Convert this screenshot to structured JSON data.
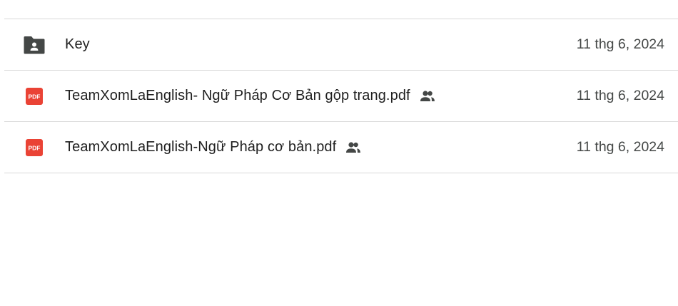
{
  "files": [
    {
      "type": "shared-folder",
      "icon": "shared-folder-icon",
      "name": "Key",
      "shared": false,
      "date": "11 thg 6, 2024"
    },
    {
      "type": "pdf",
      "icon": "pdf-icon",
      "name": "TeamXomLaEnglish- Ngữ Pháp Cơ Bản gộp trang.pdf",
      "shared": true,
      "date": "11 thg 6, 2024"
    },
    {
      "type": "pdf",
      "icon": "pdf-icon",
      "name": "TeamXomLaEnglish-Ngữ Pháp cơ bản.pdf",
      "shared": true,
      "date": "11 thg 6, 2024"
    }
  ],
  "colors": {
    "pdf_red": "#ea4335",
    "folder_dark": "#444746",
    "divider": "#d9d9d9",
    "date_text": "#444746"
  }
}
